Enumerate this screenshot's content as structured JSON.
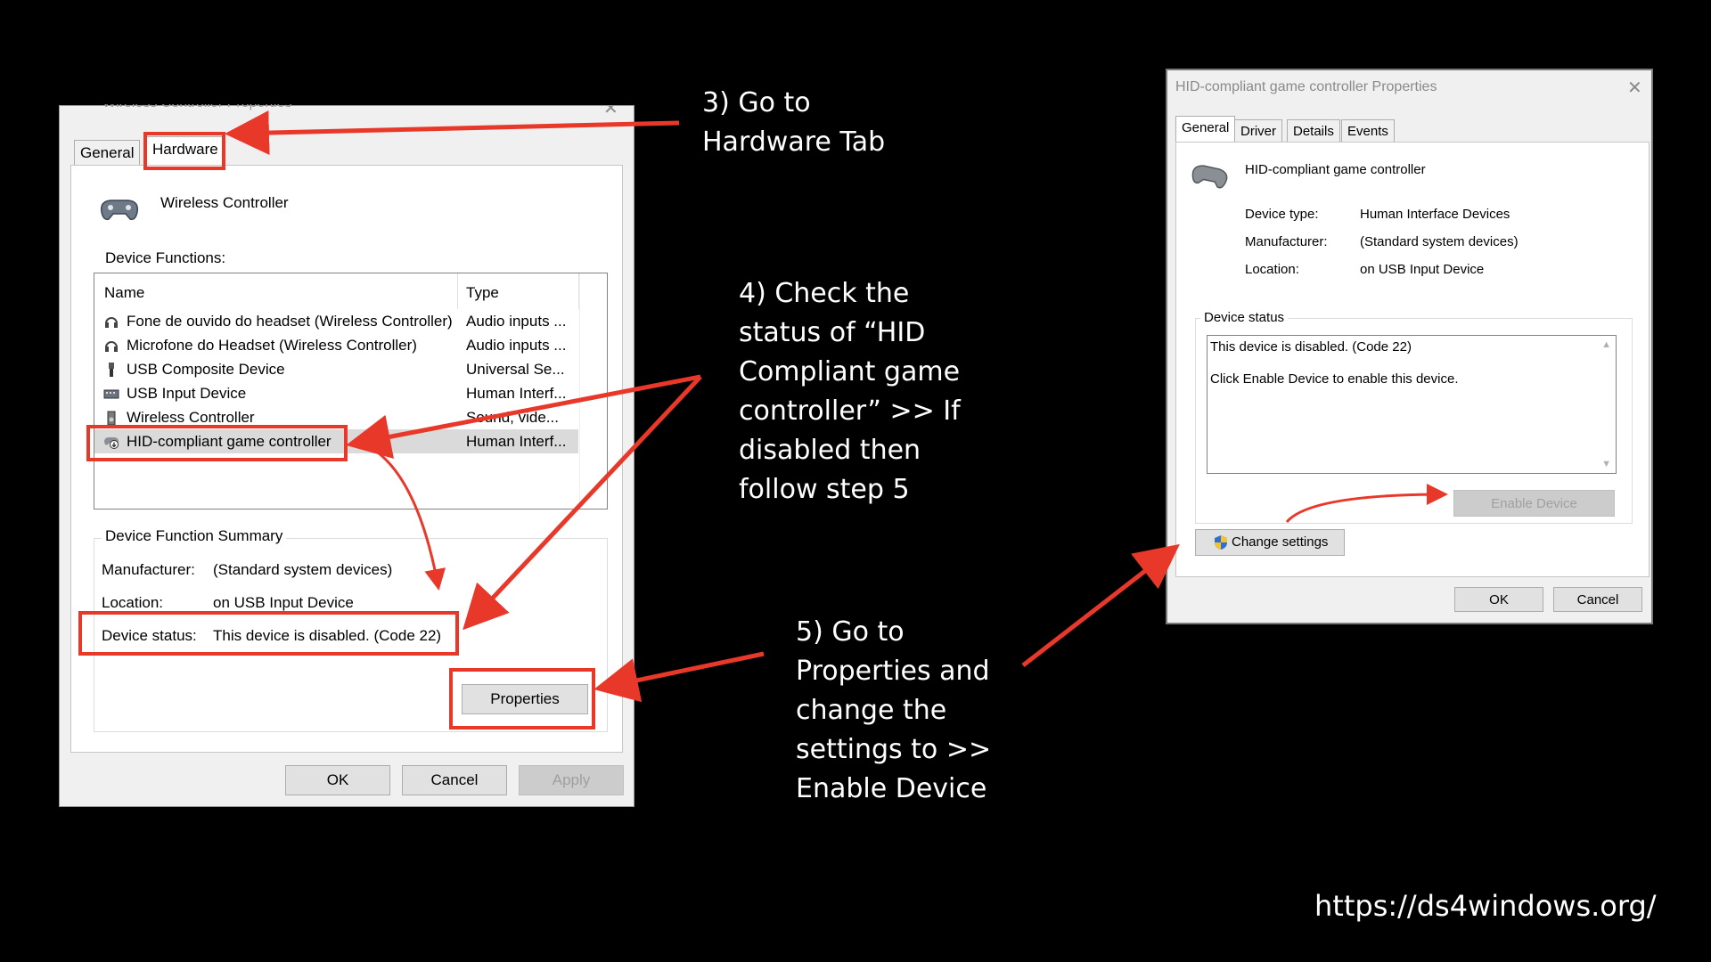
{
  "left_dialog": {
    "title": "Wireless Controller Properties",
    "tabs": [
      "General",
      "Hardware"
    ],
    "device_name": "Wireless Controller",
    "device_functions_label": "Device Functions:",
    "columns": [
      "Name",
      "Type"
    ],
    "rows": [
      {
        "name": "Fone de ouvido do headset (Wireless Controller)",
        "type": "Audio inputs ...",
        "icon": "headset-icon"
      },
      {
        "name": "Microfone do Headset (Wireless Controller)",
        "type": "Audio inputs ...",
        "icon": "headset-icon"
      },
      {
        "name": "USB Composite Device",
        "type": "Universal Se...",
        "icon": "usb-icon"
      },
      {
        "name": "USB Input Device",
        "type": "Human Interf...",
        "icon": "keyboard-icon"
      },
      {
        "name": "Wireless Controller",
        "type": "Sound, vide...",
        "icon": "speaker-icon"
      },
      {
        "name": "HID-compliant game controller",
        "type": "Human Interf...",
        "icon": "gamepad-disabled-icon"
      }
    ],
    "summary_label": "Device Function Summary",
    "manufacturer_label": "Manufacturer:",
    "manufacturer_value": "(Standard system devices)",
    "location_label": "Location:",
    "location_value": "on USB Input Device",
    "status_label": "Device status:",
    "status_value": "This device is disabled. (Code 22)",
    "properties_button": "Properties",
    "ok_button": "OK",
    "cancel_button": "Cancel",
    "apply_button": "Apply"
  },
  "right_dialog": {
    "title": "HID-compliant game controller Properties",
    "tabs": [
      "General",
      "Driver",
      "Details",
      "Events"
    ],
    "device_name": "HID-compliant game controller",
    "device_type_label": "Device type:",
    "device_type_value": "Human Interface Devices",
    "manufacturer_label": "Manufacturer:",
    "manufacturer_value": "(Standard system devices)",
    "location_label": "Location:",
    "location_value": "on USB Input Device",
    "status_group_label": "Device status",
    "status_line1": "This device is disabled. (Code 22)",
    "status_line2": "Click Enable Device to enable this device.",
    "enable_button": "Enable Device",
    "change_settings_button": "Change settings",
    "ok_button": "OK",
    "cancel_button": "Cancel"
  },
  "annotations": {
    "step3": [
      "3) Go to",
      "Hardware Tab"
    ],
    "step4": [
      "4) Check the",
      "status of “HID",
      "Compliant game",
      "controller” >> If",
      "disabled then",
      "follow step 5"
    ],
    "step5": [
      "5) Go to",
      "Properties and",
      "change the",
      "settings to >>",
      "Enable Device"
    ]
  },
  "url": "https://ds4windows.org/",
  "colors": {
    "accent_red": "#e8382a",
    "background": "#000000"
  }
}
